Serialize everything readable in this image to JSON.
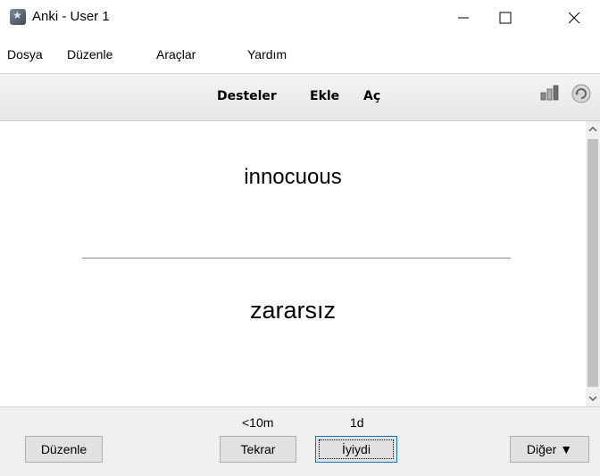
{
  "window": {
    "title": "Anki - User 1",
    "app_icon": "anki-star-icon"
  },
  "menu": {
    "items": [
      "Dosya",
      "Düzenle",
      "Araçlar",
      "Yardım"
    ]
  },
  "toolbar": {
    "links": [
      "Desteler",
      "Ekle",
      "Aç"
    ],
    "icons": [
      "stats-icon",
      "sync-icon"
    ]
  },
  "card": {
    "front": "innocuous",
    "back": "zararsız"
  },
  "answer_bar": {
    "edit_label": "Düzenle",
    "again_interval": "<10m",
    "again_label": "Tekrar",
    "good_interval": "1d",
    "good_label": "İyiydi",
    "more_label": "Diğer ▼"
  },
  "colors": {
    "toolbar_top": "#f4f4f4",
    "toolbar_bottom": "#e6e6e6",
    "bottom_bar": "#f0f0f0",
    "focus_border": "#0078d7"
  }
}
